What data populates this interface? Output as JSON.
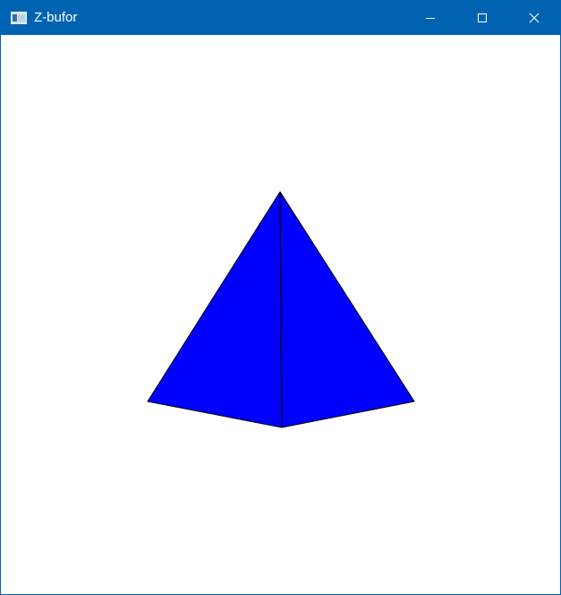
{
  "window": {
    "title": "Z-bufor",
    "icon": "app-window-icon",
    "controls": [
      "minimize-icon",
      "maximize-icon",
      "close-icon"
    ]
  },
  "colors": {
    "titlebar": "#0063b1",
    "title_text": "#ffffff",
    "canvas_background": "#ffffff",
    "face_fill": "#0000ff",
    "edge_stroke": "#000000"
  },
  "scene": {
    "object": "pyramid",
    "visible_faces": 2
  }
}
